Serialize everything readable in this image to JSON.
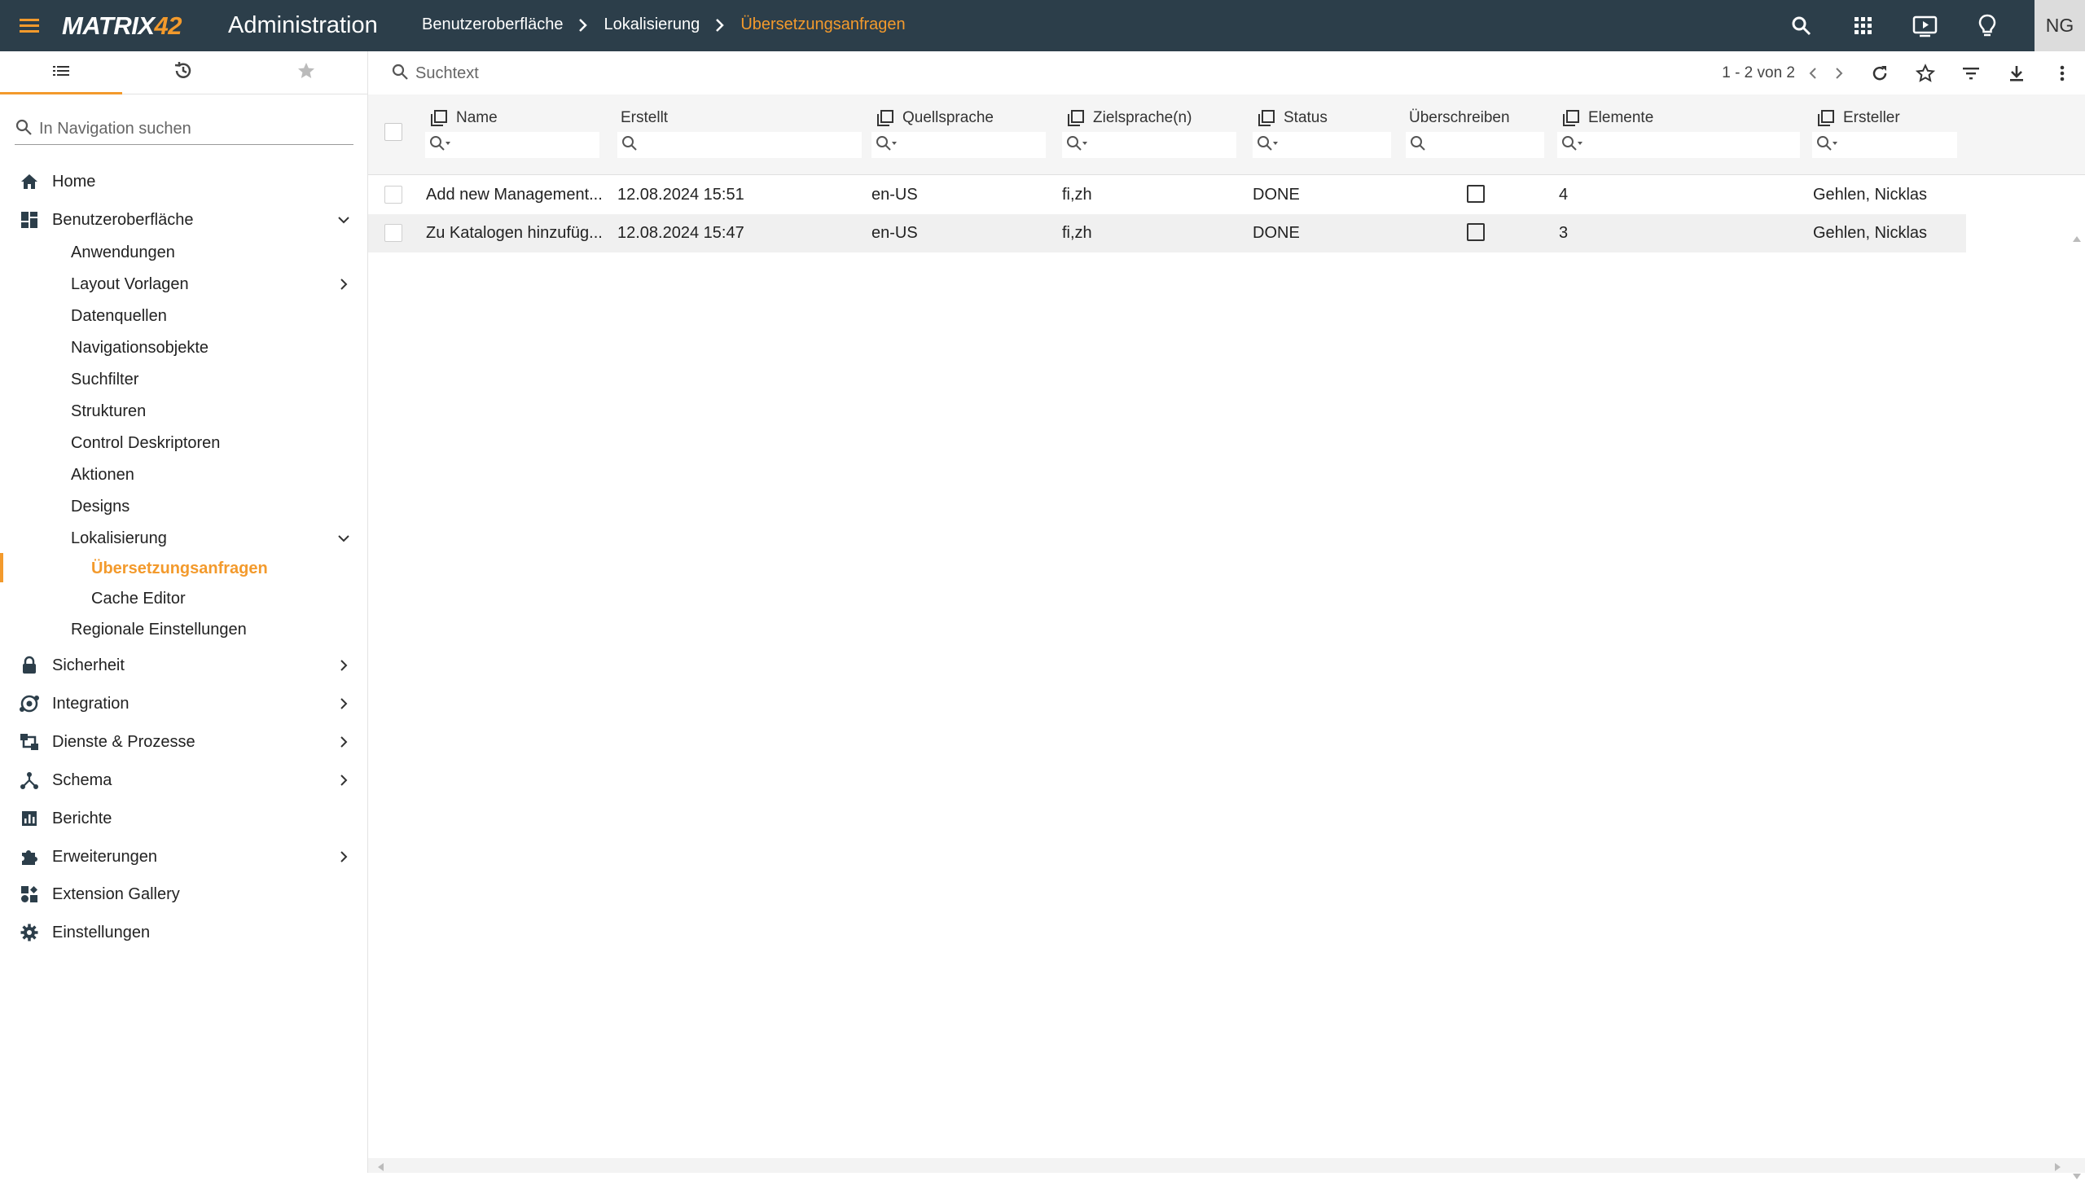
{
  "header": {
    "menu_icon": "hamburger-icon",
    "logo_text": "MATRIX",
    "logo_num": "42",
    "app_title": "Administration",
    "breadcrumb": [
      "Benutzeroberfläche",
      "Lokalisierung",
      "Übersetzungsanfragen"
    ],
    "icons": [
      "search-icon",
      "apps-grid-icon",
      "presentation-icon",
      "lightbulb-icon"
    ],
    "avatar_initials": "NG",
    "accent_color": "#f39a2c",
    "bar_color": "#2c3e4a"
  },
  "sidebar": {
    "tabs": [
      "list-icon",
      "history-icon",
      "star-icon"
    ],
    "search_placeholder": "In Navigation suchen",
    "items": [
      {
        "label": "Home",
        "icon": "home-icon"
      },
      {
        "label": "Benutzeroberfläche",
        "icon": "dashboard-icon",
        "expanded": true
      },
      {
        "label": "Anwendungen"
      },
      {
        "label": "Layout Vorlagen"
      },
      {
        "label": "Datenquellen"
      },
      {
        "label": "Navigationsobjekte"
      },
      {
        "label": "Suchfilter"
      },
      {
        "label": "Strukturen"
      },
      {
        "label": "Control Deskriptoren"
      },
      {
        "label": "Aktionen"
      },
      {
        "label": "Designs"
      },
      {
        "label": "Lokalisierung",
        "expanded": true
      },
      {
        "label": "Übersetzungsanfragen",
        "selected": true
      },
      {
        "label": "Cache Editor"
      },
      {
        "label": "Regionale Einstellungen"
      },
      {
        "label": "Sicherheit",
        "icon": "lock-icon"
      },
      {
        "label": "Integration",
        "icon": "integration-icon"
      },
      {
        "label": "Dienste & Prozesse",
        "icon": "services-icon"
      },
      {
        "label": "Schema",
        "icon": "schema-icon"
      },
      {
        "label": "Berichte",
        "icon": "reports-icon"
      },
      {
        "label": "Erweiterungen",
        "icon": "puzzle-icon"
      },
      {
        "label": "Extension Gallery",
        "icon": "gallery-icon"
      },
      {
        "label": "Einstellungen",
        "icon": "gear-icon"
      }
    ]
  },
  "toolbar": {
    "search_placeholder": "Suchtext",
    "pager": "1 - 2 von 2"
  },
  "grid": {
    "columns": [
      "Name",
      "Erstellt",
      "Quellsprache",
      "Zielsprache(n)",
      "Status",
      "Überschreiben",
      "Elemente",
      "Ersteller"
    ],
    "rows": [
      {
        "name": "Add new Management...",
        "created": "12.08.2024 15:51",
        "source": "en-US",
        "target": "fi,zh",
        "status": "DONE",
        "overwrite": false,
        "elements": "4",
        "creator": "Gehlen, Nicklas"
      },
      {
        "name": "Zu Katalogen hinzufüg...",
        "created": "12.08.2024 15:47",
        "source": "en-US",
        "target": "fi,zh",
        "status": "DONE",
        "overwrite": false,
        "elements": "3",
        "creator": "Gehlen, Nicklas"
      }
    ]
  }
}
